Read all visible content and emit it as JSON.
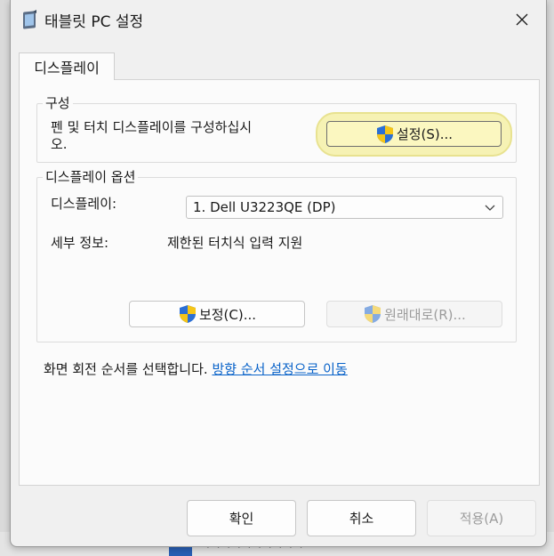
{
  "window": {
    "title": "태블릿 PC 설정",
    "close_label": "Close"
  },
  "tabs": [
    {
      "label": "디스플레이",
      "selected": true
    }
  ],
  "configure": {
    "group_label": "구성",
    "description_line1": "펜 및 터치 디스플레이를 구성하십시",
    "description_line2": "오.",
    "setup_button": "설정(S)..."
  },
  "display_options": {
    "group_label": "디스플레이 옵션",
    "display_label": "디스플레이:",
    "display_value": "1. Dell U3223QE (DP)",
    "details_label": "세부 정보:",
    "details_value": "제한된 터치식 입력 지원",
    "calibrate_button": "보정(C)...",
    "reset_button": "원래대로(R)..."
  },
  "orientation": {
    "text": "화면 회전 순서를 선택합니다.",
    "link": "방향 순서 설정으로 이동"
  },
  "footer": {
    "ok": "확인",
    "cancel": "취소",
    "apply": "적용(A)"
  },
  "background": {
    "partial_text": "· · · · · · · · · ·"
  },
  "icons": {
    "app": "tablet-pc-icon",
    "shield": "uac-shield-icon",
    "close": "close-icon",
    "dropdown": "chevron-down-icon"
  },
  "colors": {
    "accent_link": "#0a63c9",
    "highlight_button": "#fbf7c0",
    "shield_blue": "#2b6fd4",
    "shield_yellow": "#f5c518"
  }
}
